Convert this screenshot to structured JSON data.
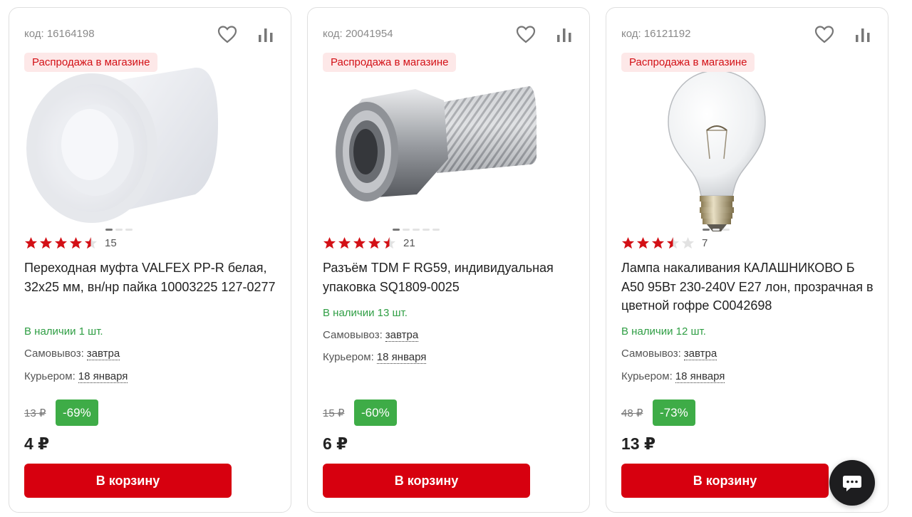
{
  "colors": {
    "accent": "#d7000f",
    "sale_badge_bg": "#fde8e8",
    "in_stock": "#2f9e44",
    "discount": "#3eac47",
    "star": "#d31016"
  },
  "products": [
    {
      "code": "код: 16164198",
      "badge": "Распродажа в магазине",
      "image": "pipe-coupling-photo",
      "slides": 3,
      "active_slide": 0,
      "rating": 4.5,
      "rating_count": "15",
      "title": "Переходная муфта VALFEX PP-R белая, 32х25 мм, вн/нр пайка 10003225 127-0277",
      "stock": "В наличии 1 шт.",
      "pickup_label": "Самовывоз:",
      "pickup_value": "завтра",
      "courier_label": "Курьером:",
      "courier_value": "18 января",
      "old_price": "13 ₽",
      "discount": "-69%",
      "price": "4 ₽",
      "cart_label": "В корзину"
    },
    {
      "code": "код: 20041954",
      "badge": "Распродажа в магазине",
      "image": "f-connector-photo",
      "slides": 4,
      "active_slide": 0,
      "rating": 4.5,
      "rating_count": "21",
      "title": "Разъём TDM F RG59, индивидуальная упаковка SQ1809-0025",
      "stock": "В наличии 13 шт.",
      "pickup_label": "Самовывоз:",
      "pickup_value": "завтра",
      "courier_label": "Курьером:",
      "courier_value": "18 января",
      "old_price": "15 ₽",
      "discount": "-60%",
      "price": "6 ₽",
      "cart_label": "В корзину"
    },
    {
      "code": "код: 16121192",
      "badge": "Распродажа в магазине",
      "image": "light-bulb-photo",
      "slides": 3,
      "active_slide": 0,
      "rating": 3.5,
      "rating_count": "7",
      "title": "Лампа накаливания КАЛАШНИКОВО Б А50 95Вт 230-240V E27 лон, прозрачная в цветной гофре C0042698",
      "stock": "В наличии 12 шт.",
      "pickup_label": "Самовывоз:",
      "pickup_value": "завтра",
      "courier_label": "Курьером:",
      "courier_value": "18 января",
      "old_price": "48 ₽",
      "discount": "-73%",
      "price": "13 ₽",
      "cart_label": "В корзину"
    }
  ],
  "chat_button": {
    "icon": "chat-bubble-icon"
  }
}
